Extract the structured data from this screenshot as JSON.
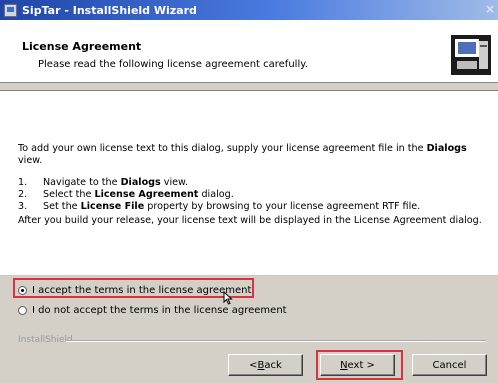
{
  "window": {
    "title": "SipTar - InstallShield Wizard",
    "close_glyph": "×"
  },
  "header": {
    "title": "License Agreement",
    "subtitle": "Please read the following license agreement carefully."
  },
  "content": {
    "intro_before": "To add your own license text to this dialog, supply your license agreement file in the ",
    "intro_bold": "Dialogs",
    "intro_after": "view.",
    "steps": [
      {
        "num": "1.",
        "before": "Navigate to the ",
        "bold": "Dialogs",
        "after": " view."
      },
      {
        "num": "2.",
        "before": "Select the ",
        "bold": "License Agreement",
        "after": " dialog."
      },
      {
        "num": "3.",
        "before": "Set the ",
        "bold": "License File",
        "after": " property by browsing to your license agreement RTF file."
      }
    ],
    "outro": "After you build your release, your license text will be displayed in the License Agreement dialog."
  },
  "options": {
    "accept_label": "I accept the terms in the license agreement",
    "decline_label": "I do not accept the terms in the license agreement",
    "selected": "accept"
  },
  "footer": {
    "brand": "InstallShield"
  },
  "buttons": {
    "back_accel": "B",
    "back_rest": "ack",
    "back_prefix": "< ",
    "next_accel": "N",
    "next_rest": "ext >",
    "cancel": "Cancel"
  },
  "colors": {
    "highlight": "#d9333f",
    "titlebar": "#1f45a8"
  }
}
